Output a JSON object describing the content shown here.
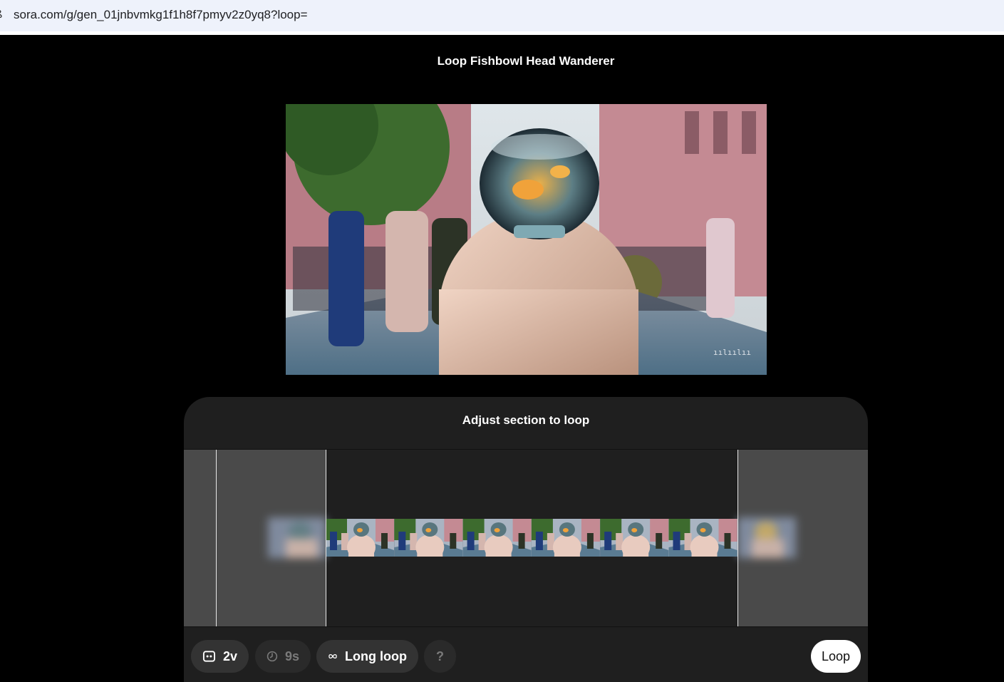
{
  "browser": {
    "url": "sora.com/g/gen_01jnbvmkg1f1h8f7pmyv2z0yq8?loop="
  },
  "page": {
    "title": "Loop Fishbowl Head Wanderer"
  },
  "panel": {
    "title": "Adjust section to loop"
  },
  "toolbar": {
    "variations": {
      "icon": "storyboard-icon",
      "label": "2v"
    },
    "duration": {
      "icon": "clock-icon",
      "label": "9s"
    },
    "loop_type": {
      "icon": "infinity-icon",
      "label": "Long loop"
    },
    "help_label": "?",
    "loop_label": "Loop"
  },
  "colors": {
    "background": "#000000",
    "panel": "#1f1f1f",
    "trimmed_region": "#4a4a4a",
    "pill": "#333333",
    "primary_button": "#ffffff"
  }
}
